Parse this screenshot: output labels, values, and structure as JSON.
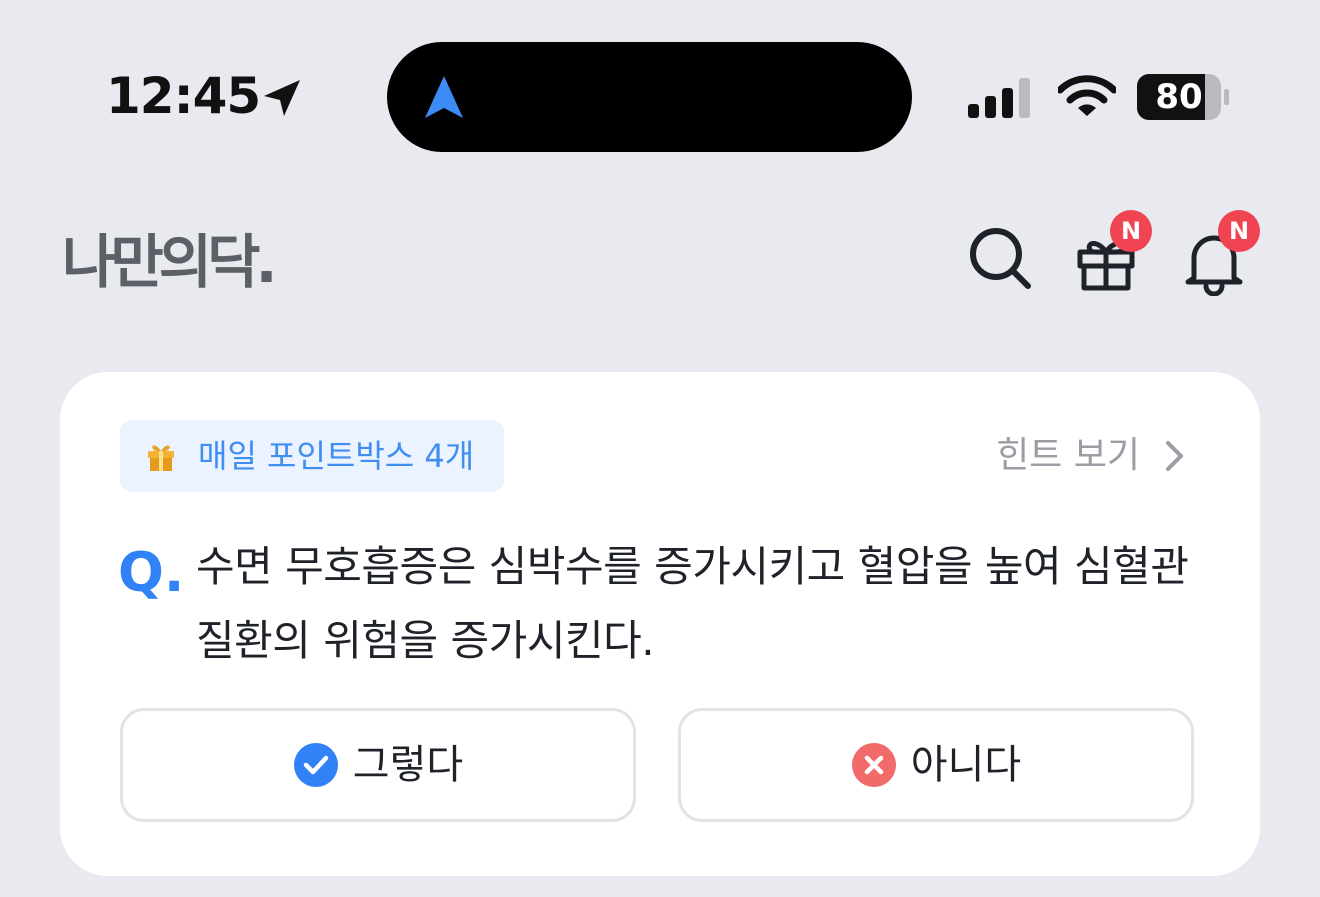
{
  "status_bar": {
    "time": "12:45",
    "battery_percent": "80",
    "icons": [
      "location-arrow-icon",
      "navigation-icon",
      "signal-icon",
      "wifi-icon",
      "battery-icon"
    ]
  },
  "header": {
    "logo_text": "나만의닥.",
    "gift_badge": "N",
    "bell_badge": "N",
    "icons": [
      "search-icon",
      "gift-icon",
      "bell-icon"
    ]
  },
  "quiz": {
    "points_label": "매일 포인트박스 4개",
    "hint_label": "힌트 보기",
    "question_mark": "Q.",
    "question_text": "수면 무호흡증은 심박수를 증가시키고 혈압을 높여 심혈관 질환의 위험을 증가시킨다.",
    "answer_yes": "그렇다",
    "answer_no": "아니다"
  },
  "colors": {
    "background": "#e9eaf0",
    "accent": "#3182f6",
    "badge": "#f04452",
    "no_icon": "#f26b6b",
    "chip_bg": "#eaf3ff"
  }
}
